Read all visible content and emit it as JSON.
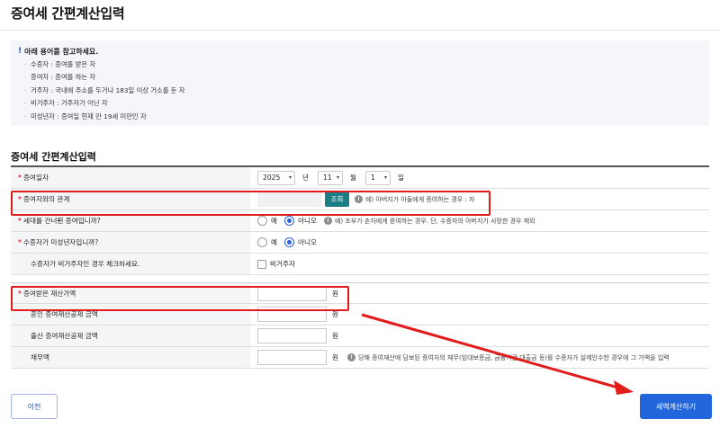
{
  "page_title": "증여세 간편계산입력",
  "notice": {
    "heading": "아래 용어를 참고하세요.",
    "items": [
      "수증자 : 증여를 받은 자",
      "증여자 : 증여를 하는 자",
      "거주자 : 국내에 주소를 두거나 183일 이상 거소를 둔 자",
      "비거주자 : 거주자가 아닌 자",
      "미성년자 : 증여일 현재 만 19세 미만인 자"
    ]
  },
  "section_title": "증여세 간편계산입력",
  "form": {
    "gift_date": {
      "label": "증여일자",
      "year": "2025",
      "year_unit": "년",
      "month": "11",
      "month_unit": "월",
      "day": "1",
      "day_unit": "일"
    },
    "relation": {
      "label": "증여자와의 관계",
      "button": "조회",
      "hint": "예) 아버지가 아들에게 증여하는 경우 : 자"
    },
    "generation_skip": {
      "label": "세대를 건너뛴 증여입니까?",
      "options": [
        "예",
        "아니오"
      ],
      "selected": "아니오",
      "hint": "예) 조부가 손자에게 증여하는 경우. 단, 수증자의 아버지가 사망한 경우 제외"
    },
    "minor": {
      "label": "수증자가 미성년자입니까?",
      "options": [
        "예",
        "아니오"
      ],
      "selected": "아니오"
    },
    "nonresident": {
      "label": "수증자가 비거주자인 경우 체크하세요.",
      "checkbox_label": "비거주자",
      "checked": false
    },
    "gift_value": {
      "label": "증여받은 재산가액",
      "value": "",
      "unit": "원"
    },
    "marriage_deduction": {
      "label": "혼인 증여재산공제 금액",
      "value": "",
      "unit": "원"
    },
    "birth_deduction": {
      "label": "출산 증여재산공제 금액",
      "value": "",
      "unit": "원"
    },
    "debt": {
      "label": "채무액",
      "value": "",
      "unit": "원",
      "hint": "당해 증여재산에 담보된 증여자의 채무(임대보증금, 금융기관 대출금 등)를 수증자가 실제인수한 경우에 그 가액을 입력"
    }
  },
  "buttons": {
    "prev": "이전",
    "calculate": "세액계산하기"
  },
  "colors": {
    "primary": "#2366dc",
    "search_button": "#1b7e86",
    "required_mark": "#d4303c",
    "annotation": "#e21b1b"
  }
}
